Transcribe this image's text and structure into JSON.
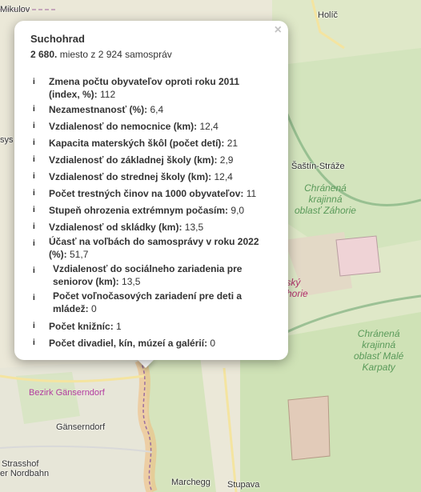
{
  "map": {
    "labels": {
      "mikulov": "Mikulov",
      "holic": "Holíč",
      "sastin": "Šaštín-Stráže",
      "bezirk": "Bezirk Gänserndorf",
      "ganserndorf": "Gänserndorf",
      "strasshof": "Strasshof",
      "nordbahn": "er Nordbahn",
      "marchegg": "Marchegg",
      "stupava": "Stupava",
      "sys": "sys",
      "cho_zahorie": [
        "Chránená",
        "krajinná",
        "oblasť Záhorie"
      ],
      "cho_male_karpaty": [
        "Chránená",
        "krajinná",
        "oblasť Malé",
        "Karpaty"
      ],
      "zahorie_pink": [
        "enský",
        "Záhorie"
      ]
    }
  },
  "popup": {
    "close": "×",
    "title": "Suchohrad",
    "rank_bold": "2 680.",
    "rank_rest": " miesto z 2 924 samospráv",
    "info_icon": "i",
    "rows": [
      {
        "label": "Zmena počtu obyvateľov oproti roku 2011 (index, %):",
        "value": " 112"
      },
      {
        "label": "Nezamestnanosť (%):",
        "value": " 6,4"
      },
      {
        "label": "Vzdialenosť do nemocnice (km):",
        "value": " 12,4"
      },
      {
        "label": "Kapacita materských škôl (počet detí):",
        "value": " 21"
      },
      {
        "label": "Vzdialenosť do základnej školy (km):",
        "value": " 2,9"
      },
      {
        "label": "Vzdialenosť do strednej školy (km):",
        "value": " 12,4"
      },
      {
        "label": "Počet trestných činov na 1000 obyvateľov:",
        "value": " 11"
      },
      {
        "label": "Stupeň ohrozenia extrémnym počasím:",
        "value": " 9,0"
      },
      {
        "label": "Vzdialenosť od skládky (km):",
        "value": " 13,5"
      },
      {
        "label": "Účasť na voľbách do samosprávy v roku 2022 (%):",
        "value": " 51,7"
      },
      {
        "label": "Vzdialenosť do sociálneho zariadenia pre seniorov (km):",
        "value": " 13,5"
      },
      {
        "label": "Počet voľnočasových zariadení pre deti a mládež:",
        "value": " 0"
      },
      {
        "label": "Počet knižníc:",
        "value": " 1"
      },
      {
        "label": "Počet divadiel, kín, múzeí a galérií:",
        "value": " 0"
      }
    ]
  }
}
